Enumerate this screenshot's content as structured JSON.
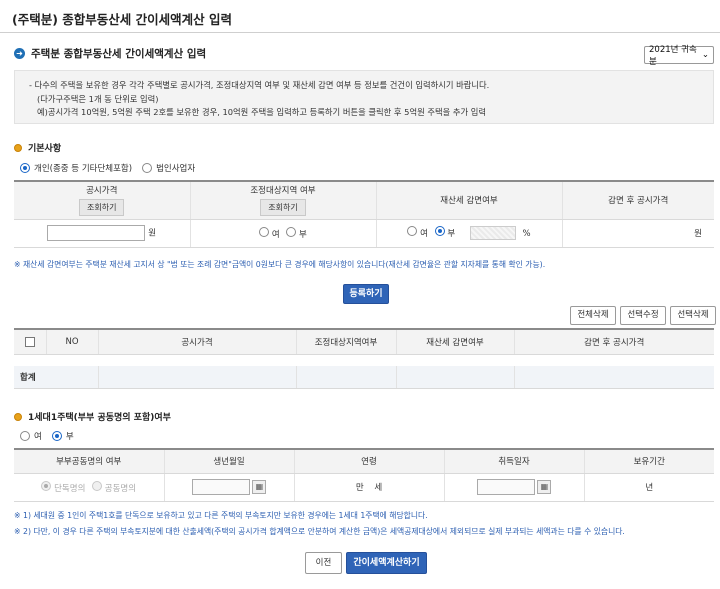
{
  "page": {
    "title": "(주택분) 종합부동산세 간이세액계산 입력",
    "section_title": "주택분 종합부동산세 간이세액계산 입력",
    "year_select": "2021년 귀속분"
  },
  "notice": {
    "line1": "다수의 주택을 보유한 경우 각각 주택별로 공시가격, 조정대상지역 여부 및 재산세 감면 여부 등 정보를 건건이 입력하시기 바랍니다.",
    "line2": "(다가구주택은 1개 동 단위로 입력)",
    "line3": "예)공시가격 10억원, 5억원 주택 2호를 보유한 경우, 10억원 주택을 입력하고 등록하기 버튼을 클릭한 후 5억원 주택을 추가 입력"
  },
  "basic": {
    "heading": "기본사항",
    "radio_individual": "개인(종중 등 기타단체포함)",
    "radio_corporate": "법인사업자",
    "headers": {
      "price": "공시가격",
      "region": "조정대상지역 여부",
      "reduction": "재산세 감면여부",
      "after": "감면 후 공시가격"
    },
    "lookup_btn": "조회하기",
    "won": "원",
    "yes": "여",
    "no": "부",
    "percent": "%"
  },
  "notes": {
    "reduction_note": "※ 재산세 감면여부는 주택분 재산세 고지서 상 \"법 또는 조례 감면\"금액이 0원보다 큰 경우에 해당사항이 있습니다(재산세 감면율은 관할 지자체를 통해 확인 가능).",
    "note1": "※ 1) 세대원 중 1인이 주택1호를 단독으로 보유하고 있고 다른 주택의 부속토지만 보유한 경우에는 1세대 1주택에 해당합니다.",
    "note2": "※ 2) 다만, 이 경우 다른 주택의 부속토지분에 대한 산출세액(주택의 공시가격 합계액으로 안분하여 계산한 금액)은 세액공제대상에서 제외되므로 실제 부과되는 세액과는 다를 수 있습니다."
  },
  "buttons": {
    "register": "등록하기",
    "delete_all": "전체삭제",
    "edit_selected": "선택수정",
    "delete_selected": "선택삭제",
    "prev": "이전",
    "calculate": "간이세액계산하기"
  },
  "list": {
    "headers": [
      "NO",
      "공시가격",
      "조정대상지역여부",
      "재산세 감면여부",
      "감면 후 공시가격"
    ],
    "total_label": "합계"
  },
  "single": {
    "heading": "1세대1주택(부부 공동명의 포함)여부",
    "yes": "여",
    "no": "부",
    "headers": [
      "부부공동명의 여부",
      "생년월일",
      "연령",
      "취득일자",
      "보유기간"
    ],
    "sole": "단독명의",
    "joint": "공동명의",
    "age_unit_man": "만",
    "age_unit_se": "세",
    "year_unit": "년"
  }
}
